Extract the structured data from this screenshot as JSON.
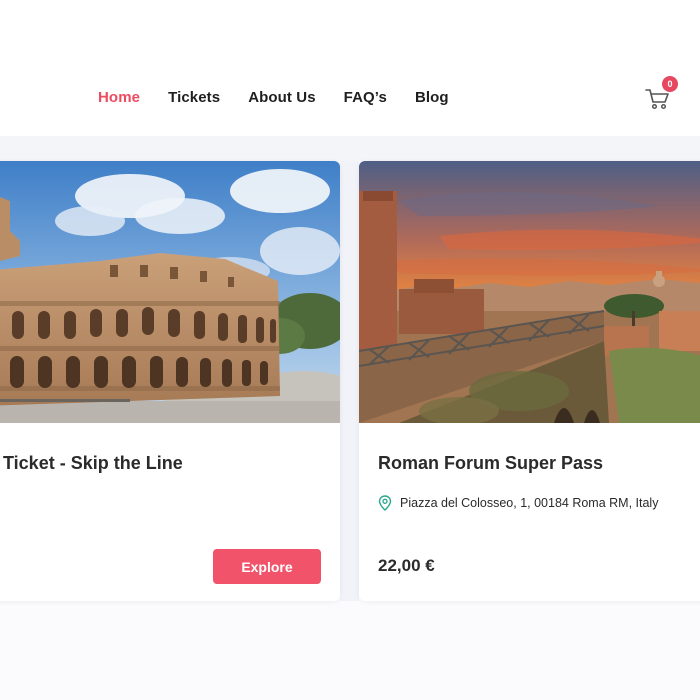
{
  "nav": {
    "items": [
      {
        "label": "Home",
        "active": true
      },
      {
        "label": "Tickets",
        "active": false
      },
      {
        "label": "About Us",
        "active": false
      },
      {
        "label": "FAQ’s",
        "active": false
      },
      {
        "label": "Blog",
        "active": false
      }
    ],
    "active_color": "#ee4b60"
  },
  "cart": {
    "count": "0",
    "icon": "shopping-cart-icon",
    "badge_color": "#e8485f"
  },
  "cards": [
    {
      "title": "Ticket - Skip the Line",
      "image": "colosseum-photo",
      "button_label": "Explore",
      "button_color": "#f0536a"
    },
    {
      "title": "Roman Forum Super Pass",
      "image": "roman-forum-sunset-photo",
      "location_icon": "map-pin-icon",
      "location": "Piazza del Colosseo, 1, 00184 Roma RM, Italy",
      "price": "22,00 €"
    }
  ]
}
